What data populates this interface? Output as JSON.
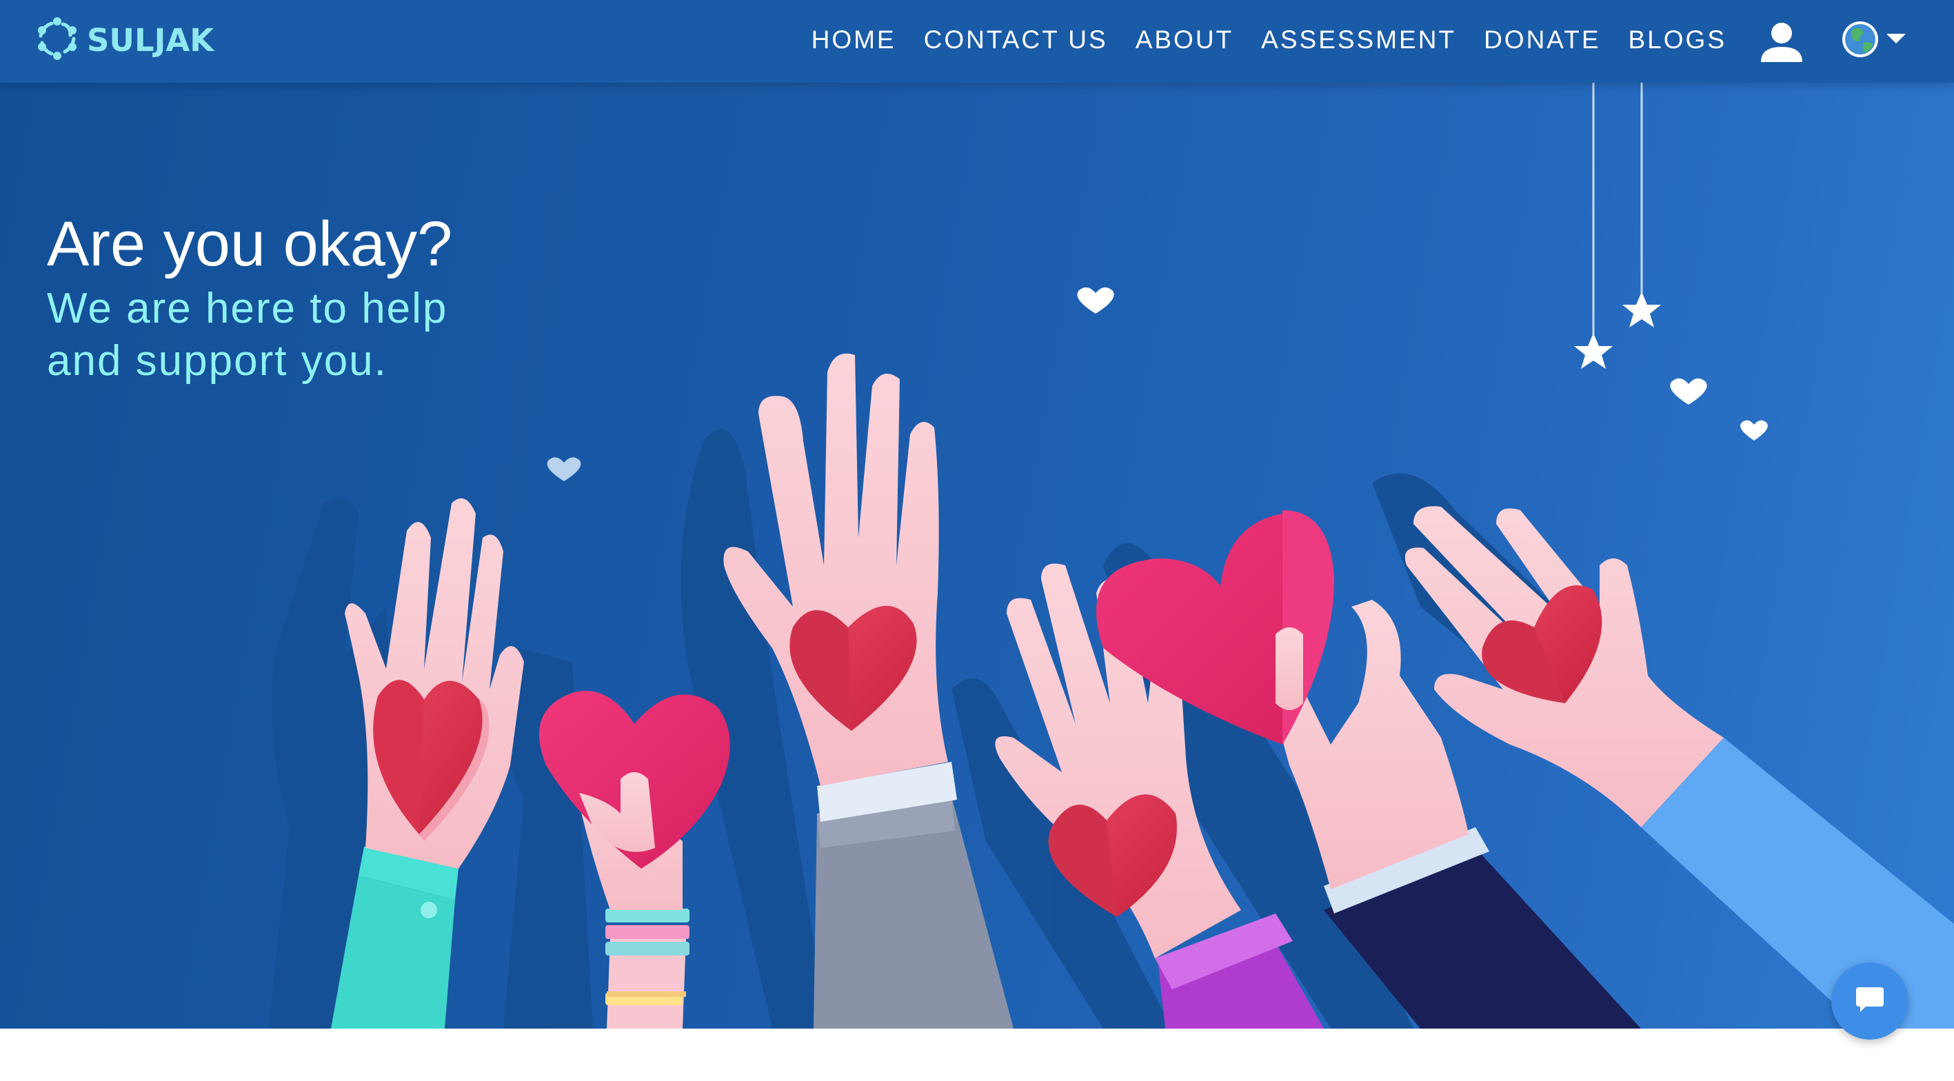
{
  "brand": {
    "name": "SULJAK",
    "logo_icon": "people-circle-logo"
  },
  "nav": {
    "links": [
      "HOME",
      "CONTACT US",
      "ABOUT",
      "ASSESSMENT",
      "DONATE",
      "BLOGS"
    ],
    "user_icon": "user-icon",
    "language_icon": "globe-icon"
  },
  "hero": {
    "title": "Are you okay?",
    "subtitle": "We are here to help and support you."
  },
  "chat": {
    "icon": "chat-bubble-icon"
  },
  "colors": {
    "navbar": "#1a5ba7",
    "hero_start": "#124f96",
    "hero_end": "#2f7ad0",
    "accent_text": "#8ff2f2",
    "chat_button": "#3e8ee8",
    "heart": "#e0365a"
  }
}
